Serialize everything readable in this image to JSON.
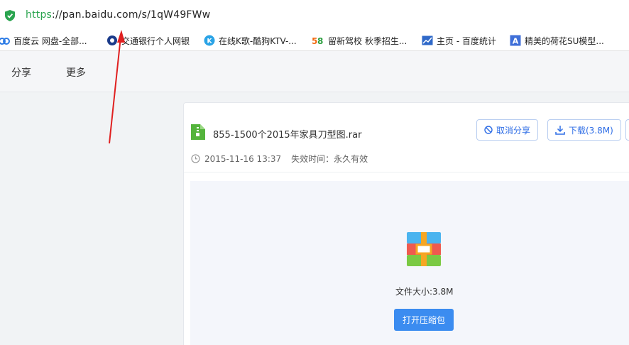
{
  "browser": {
    "url_scheme": "https",
    "url_rest": "://pan.baidu.com/s/1qW49FWw"
  },
  "bookmarks": [
    {
      "label": "百度云 网盘-全部...",
      "icon": "baidu-cloud-icon"
    },
    {
      "label": "交通银行个人网银",
      "icon": "bank-icon"
    },
    {
      "label": "在线K歌-酷狗KTV-...",
      "icon": "kugou-icon"
    },
    {
      "label": "留新驾校 秋季招生...",
      "icon": "58-icon"
    },
    {
      "label": "主页 - 百度统计",
      "icon": "chart-icon"
    },
    {
      "label": "精美的荷花SU模型...",
      "icon": "letter-a-icon"
    }
  ],
  "nav": {
    "share": "分享",
    "more": "更多"
  },
  "file": {
    "name": "855-1500个2015年家具刀型图.rar",
    "date": "2015-11-16 13:37",
    "expire": "失效时间：永久有效",
    "cancel_share": "取消分享",
    "download": "下载(3.8M)",
    "size_label": "文件大小:3.8M",
    "open_button": "打开压缩包"
  },
  "colors": {
    "accent": "#3b8cf0",
    "secure": "#2aa44f",
    "annotation": "#e02020"
  }
}
